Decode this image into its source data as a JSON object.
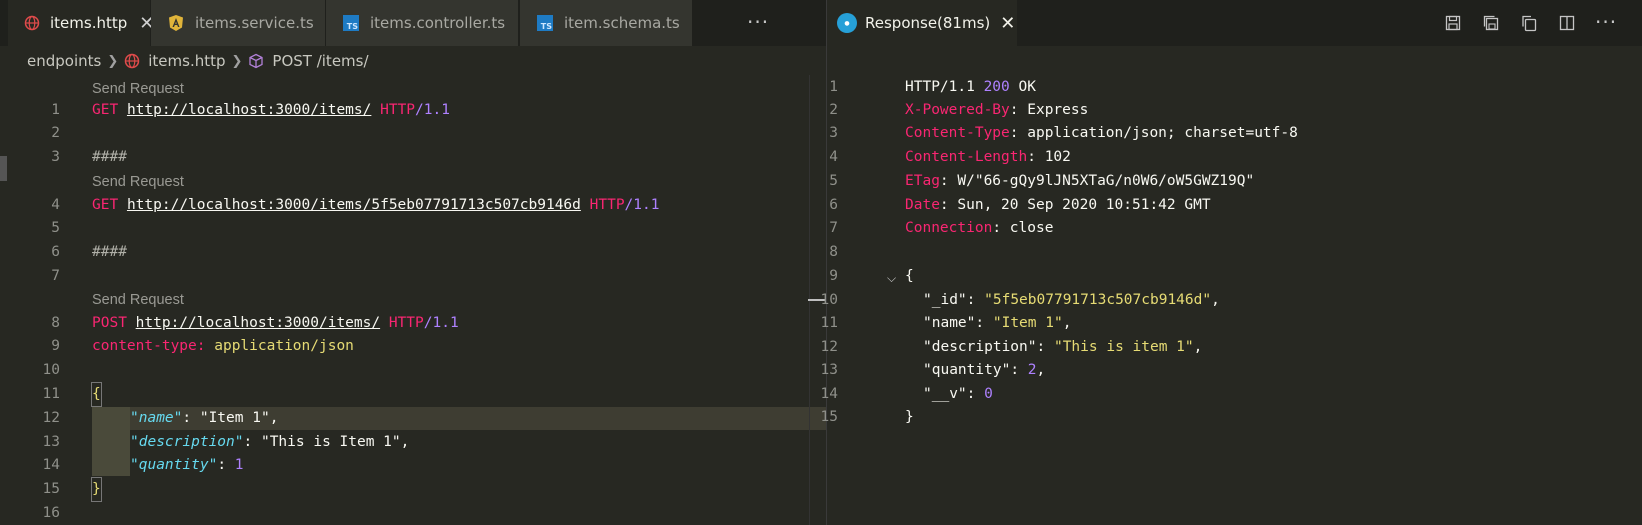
{
  "left_pane": {
    "tabs": [
      {
        "label": "items.http",
        "icon": "globe-icon",
        "active": true
      },
      {
        "label": "items.service.ts",
        "icon": "angular-icon",
        "active": false
      },
      {
        "label": "items.controller.ts",
        "icon": "typescript-icon",
        "active": false
      },
      {
        "label": "item.schema.ts",
        "icon": "typescript-icon",
        "active": false
      }
    ],
    "more_label": "···",
    "breadcrumb": {
      "folder": "endpoints",
      "file": "items.http",
      "symbol": "POST /items/"
    },
    "code_lens_label": "Send Request",
    "lines": [
      {
        "n": "1"
      },
      {
        "n": "2"
      },
      {
        "n": "3"
      },
      {
        "n": "4"
      },
      {
        "n": "5"
      },
      {
        "n": "6"
      },
      {
        "n": "7"
      },
      {
        "n": "8"
      },
      {
        "n": "9"
      },
      {
        "n": "10"
      },
      {
        "n": "11"
      },
      {
        "n": "12"
      },
      {
        "n": "13"
      },
      {
        "n": "14"
      },
      {
        "n": "15"
      },
      {
        "n": "16"
      }
    ],
    "code": {
      "l1_method": "GET",
      "l1_url": "http://localhost:3000/items/",
      "l1_proto": "HTTP",
      "l1_ver": "/1.1",
      "l3": "####",
      "l4_method": "GET",
      "l4_url": "http://localhost:3000/items/5f5eb07791713c507cb9146d",
      "l4_proto": "HTTP",
      "l4_ver": "/1.1",
      "l6": "####",
      "l8_method": "POST",
      "l8_url": "http://localhost:3000/items/",
      "l8_proto": "HTTP",
      "l8_ver": "/1.1",
      "l9_key": "content-type:",
      "l9_val": "application/json",
      "l11": "{",
      "l12_key": "\"name\"",
      "l12_rest": ": \"Item 1\",",
      "l13_key": "\"description\"",
      "l13_rest": ": \"This is Item 1\",",
      "l14_key": "\"quantity\"",
      "l14_colon": ": ",
      "l14_val": "1",
      "l15": "}"
    }
  },
  "right_pane": {
    "tab_label": "Response(81ms)",
    "tab_icon": "rest-client-icon",
    "toolbar_icons": [
      "save-icon",
      "save-body-icon",
      "copy-icon",
      "split-editor-icon",
      "more-icon"
    ],
    "more_label": "···",
    "lines": [
      {
        "n": "1"
      },
      {
        "n": "2"
      },
      {
        "n": "3"
      },
      {
        "n": "4"
      },
      {
        "n": "5"
      },
      {
        "n": "6"
      },
      {
        "n": "7"
      },
      {
        "n": "8"
      },
      {
        "n": "9"
      },
      {
        "n": "10"
      },
      {
        "n": "11"
      },
      {
        "n": "12"
      },
      {
        "n": "13"
      },
      {
        "n": "14"
      },
      {
        "n": "15"
      }
    ],
    "response": {
      "status_proto": "HTTP/1.1",
      "status_code": "200",
      "status_text": "OK",
      "h2_key": "X-Powered-By",
      "h2_val": "Express",
      "h3_key": "Content-Type",
      "h3_val": "application/json; charset=utf-8",
      "h4_key": "Content-Length",
      "h4_val": "102",
      "h5_key": "ETag",
      "h5_val": "W/\"66-gQy9lJN5XTaG/n0W6/oW5GWZ19Q\"",
      "h6_key": "Date",
      "h6_val": "Sun, 20 Sep 2020 10:51:42 GMT",
      "h7_key": "Connection",
      "h7_val": "close",
      "open_brace": "{",
      "b10_key": "\"_id\"",
      "b10_val": "\"5f5eb07791713c507cb9146d\"",
      "b11_key": "\"name\"",
      "b11_val": "\"Item 1\"",
      "b12_key": "\"description\"",
      "b12_val": "\"This is item 1\"",
      "b13_key": "\"quantity\"",
      "b13_val": "2",
      "b14_key": "\"__v\"",
      "b14_val": "0",
      "close_brace": "}"
    }
  }
}
